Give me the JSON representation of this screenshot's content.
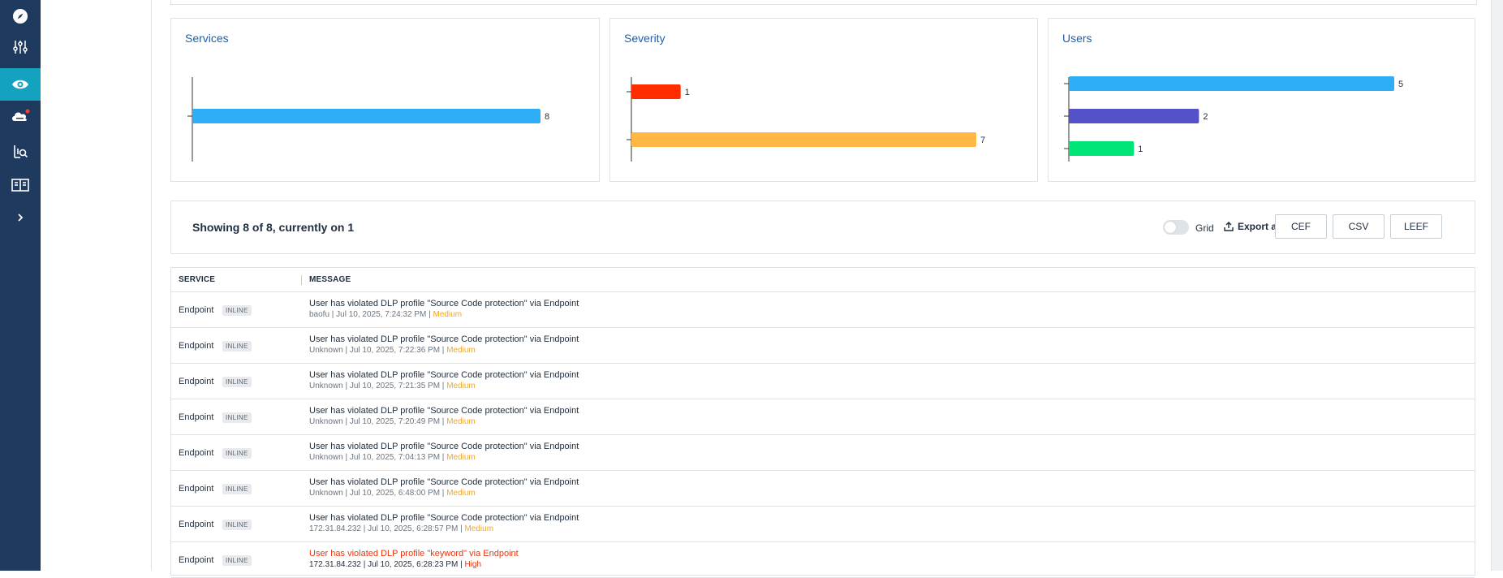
{
  "nav": {
    "items": [
      {
        "icon": "compass-icon",
        "active": false
      },
      {
        "icon": "sliders-icon",
        "active": false
      },
      {
        "icon": "eye-icon",
        "active": true
      },
      {
        "icon": "cloud-alert-icon",
        "active": false
      },
      {
        "icon": "chart-search-icon",
        "active": false
      },
      {
        "icon": "book-icon",
        "active": false
      },
      {
        "icon": "chevron-right-icon",
        "active": false
      }
    ]
  },
  "cards": {
    "services": {
      "title": "Services",
      "chart_data": {
        "type": "bar",
        "orientation": "horizontal",
        "categories": [
          ""
        ],
        "values": [
          8
        ],
        "colors": [
          "#2eaef6"
        ]
      }
    },
    "severity": {
      "title": "Severity",
      "chart_data": {
        "type": "bar",
        "orientation": "horizontal",
        "categories": [
          "",
          ""
        ],
        "values": [
          1,
          7
        ],
        "colors": [
          "#ff2d00",
          "#ffb845"
        ]
      }
    },
    "users": {
      "title": "Users",
      "chart_data": {
        "type": "bar",
        "orientation": "horizontal",
        "categories": [
          "",
          "",
          ""
        ],
        "values": [
          5,
          2,
          1
        ],
        "colors": [
          "#2eaef6",
          "#5551c9",
          "#00e676"
        ]
      }
    }
  },
  "summary": {
    "text": "Showing 8 of 8, currently on 1",
    "grid_label": "Grid",
    "export_label": "Export as",
    "formats": [
      "CEF",
      "CSV",
      "LEEF"
    ]
  },
  "table": {
    "headers": {
      "service": "SERVICE",
      "message": "MESSAGE"
    },
    "rows": [
      {
        "service": "Endpoint",
        "tag": "INLINE",
        "message": "User has violated DLP profile \"Source Code protection\" via Endpoint",
        "meta": "baofu | Jul 10, 2025, 7:24:32 PM | ",
        "severity": "Medium"
      },
      {
        "service": "Endpoint",
        "tag": "INLINE",
        "message": "User has violated DLP profile \"Source Code protection\" via Endpoint",
        "meta": "Unknown | Jul 10, 2025, 7:22:36 PM | ",
        "severity": "Medium"
      },
      {
        "service": "Endpoint",
        "tag": "INLINE",
        "message": "User has violated DLP profile \"Source Code protection\" via Endpoint",
        "meta": "Unknown | Jul 10, 2025, 7:21:35 PM | ",
        "severity": "Medium"
      },
      {
        "service": "Endpoint",
        "tag": "INLINE",
        "message": "User has violated DLP profile \"Source Code protection\" via Endpoint",
        "meta": "Unknown | Jul 10, 2025, 7:20:49 PM | ",
        "severity": "Medium"
      },
      {
        "service": "Endpoint",
        "tag": "INLINE",
        "message": "User has violated DLP profile \"Source Code protection\" via Endpoint",
        "meta": "Unknown | Jul 10, 2025, 7:04:13 PM | ",
        "severity": "Medium"
      },
      {
        "service": "Endpoint",
        "tag": "INLINE",
        "message": "User has violated DLP profile \"Source Code protection\" via Endpoint",
        "meta": "Unknown | Jul 10, 2025, 6:48:00 PM | ",
        "severity": "Medium"
      },
      {
        "service": "Endpoint",
        "tag": "INLINE",
        "message": "User has violated DLP profile \"Source Code protection\" via Endpoint",
        "meta": "172.31.84.232 | Jul 10, 2025, 6:28:57 PM | ",
        "severity": "Medium"
      },
      {
        "service": "Endpoint",
        "tag": "INLINE",
        "message": "User has violated DLP profile \"keyword\" via Endpoint",
        "meta": "172.31.84.232 | Jul 10, 2025, 6:28:23 PM | ",
        "severity": "High"
      }
    ]
  },
  "colors": {
    "nav_bg": "#1f3a5f",
    "nav_active": "#13a3be",
    "title_blue": "#1f5fa8",
    "medium": "#f5a623",
    "high": "#e8340c"
  }
}
